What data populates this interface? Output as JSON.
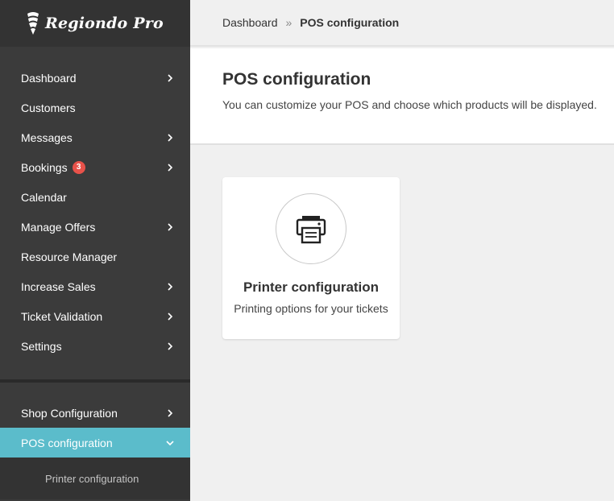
{
  "brand": {
    "name": "Regiondo Pro"
  },
  "sidebar": {
    "items": [
      {
        "label": "Dashboard",
        "chevron": true
      },
      {
        "label": "Customers",
        "chevron": false
      },
      {
        "label": "Messages",
        "chevron": true
      },
      {
        "label": "Bookings",
        "chevron": true,
        "badge": "3"
      },
      {
        "label": "Calendar",
        "chevron": false
      },
      {
        "label": "Manage Offers",
        "chevron": true
      },
      {
        "label": "Resource Manager",
        "chevron": false
      },
      {
        "label": "Increase Sales",
        "chevron": true
      },
      {
        "label": "Ticket Validation",
        "chevron": true
      },
      {
        "label": "Settings",
        "chevron": true
      }
    ],
    "bottom_items": [
      {
        "label": "Shop Configuration",
        "chevron": "right"
      },
      {
        "label": "POS configuration",
        "chevron": "down",
        "active": true
      }
    ],
    "sub_items": [
      {
        "label": "Printer configuration"
      }
    ],
    "colors": {
      "background": "#3b3b3b",
      "active": "#5bbccb",
      "badge": "#e8524a"
    }
  },
  "breadcrumb": {
    "home": "Dashboard",
    "separator": "»",
    "current": "POS configuration"
  },
  "header": {
    "title": "POS configuration",
    "description": "You can customize your POS and choose which products will be displayed."
  },
  "cards": [
    {
      "title": "Printer configuration",
      "description": "Printing options for your tickets",
      "icon": "printer-icon"
    }
  ]
}
